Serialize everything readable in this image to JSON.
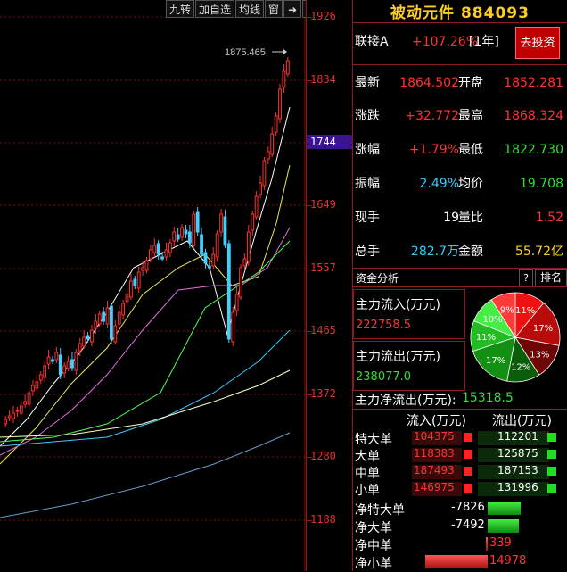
{
  "toolbar": {
    "items": [
      "九转",
      "加自选",
      "均线",
      "窗"
    ]
  },
  "axis": {
    "labels": [
      "1926",
      "1834",
      "1744",
      "1649",
      "1557",
      "1465",
      "1372",
      "1280",
      "1188"
    ],
    "highlight": "1744"
  },
  "chart": {
    "peak_label": "1875.465"
  },
  "panel": {
    "title": "被动元件 884093",
    "link": {
      "label": "联接A",
      "value": "+107.26%",
      "period": "[1年]",
      "button": "去投资"
    },
    "quote": [
      {
        "k1": "最新",
        "v1": "1864.502",
        "k2": "开盘",
        "v2": "1852.281"
      },
      {
        "k1": "涨跌",
        "v1": "+32.772",
        "k2": "最高",
        "v2": "1868.324"
      },
      {
        "k1": "涨幅",
        "v1": "+1.79%",
        "k2": "最低",
        "v2": "1822.730"
      },
      {
        "k1": "振幅",
        "v1": "2.49%",
        "k2": "均价",
        "v2": "19.708"
      },
      {
        "k1": "现手",
        "v1": "19",
        "k2": "量比",
        "v2": "1.52"
      },
      {
        "k1": "总手",
        "v1": "282.7万",
        "k2": "金额",
        "v2": "55.72亿"
      }
    ],
    "fund": {
      "header": "资金分析",
      "q": "?",
      "rank": "排名",
      "inflow_label": "主力流入(万元)",
      "inflow_value": "222758.5",
      "outflow_label": "主力流出(万元)",
      "outflow_value": "238077.0",
      "net_label": "主力净流出(万元):",
      "net_value": "15318.5",
      "pie": [
        {
          "label": "11%",
          "value": 11,
          "color": "#ee1111"
        },
        {
          "label": "17%",
          "value": 17,
          "color": "#b80c0c"
        },
        {
          "label": "13%",
          "value": 13,
          "color": "#6e0606"
        },
        {
          "label": "12%",
          "value": 12,
          "color": "#0a5e0a"
        },
        {
          "label": "17%",
          "value": 17,
          "color": "#138f13"
        },
        {
          "label": "11%",
          "value": 11,
          "color": "#22bb22"
        },
        {
          "label": "10%",
          "value": 10,
          "color": "#44ee44"
        },
        {
          "label": "9%",
          "value": 9,
          "color": "#ff3a3a"
        }
      ],
      "flow_headers": [
        "流入(万元)",
        "流出(万元)"
      ],
      "flows": [
        {
          "name": "特大单",
          "in": "104375",
          "out": "112201"
        },
        {
          "name": "大单",
          "in": "118383",
          "out": "125875"
        },
        {
          "name": "中单",
          "in": "187493",
          "out": "187153"
        },
        {
          "name": "小单",
          "in": "146975",
          "out": "131996"
        }
      ],
      "net": [
        {
          "name": "净特大单",
          "value": "-7826",
          "num": -7826
        },
        {
          "name": "净大单",
          "value": "-7492",
          "num": -7492
        },
        {
          "name": "净中单",
          "value": "339",
          "num": 339
        },
        {
          "name": "净小单",
          "value": "14978",
          "num": 14978
        }
      ]
    }
  }
}
